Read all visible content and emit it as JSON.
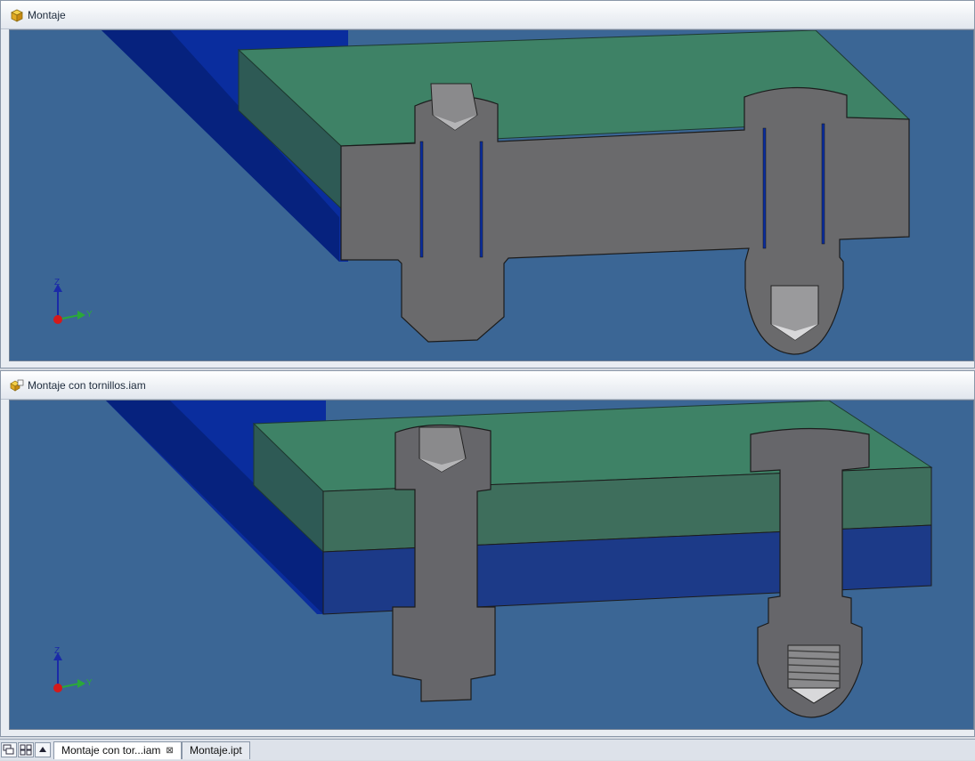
{
  "windows": {
    "top": {
      "title": "Montaje"
    },
    "bottom": {
      "title": "Montaje con tornillos.iam"
    }
  },
  "triad": {
    "z_label": "Z",
    "y_label": "Y"
  },
  "tabs": [
    {
      "label": "Montaje con tor...iam",
      "active": true,
      "close": "⊠"
    },
    {
      "label": "Montaje.ipt",
      "active": false
    }
  ],
  "colors": {
    "viewport_bg": "#3b6695",
    "plate_top": "#3e8266",
    "plate_side": "#2e5a55",
    "plate_blue": "#0a2d9e",
    "section_gray": "#6a6a6c",
    "section_green": "#3e6e5c",
    "section_blue": "#1c3a88"
  }
}
